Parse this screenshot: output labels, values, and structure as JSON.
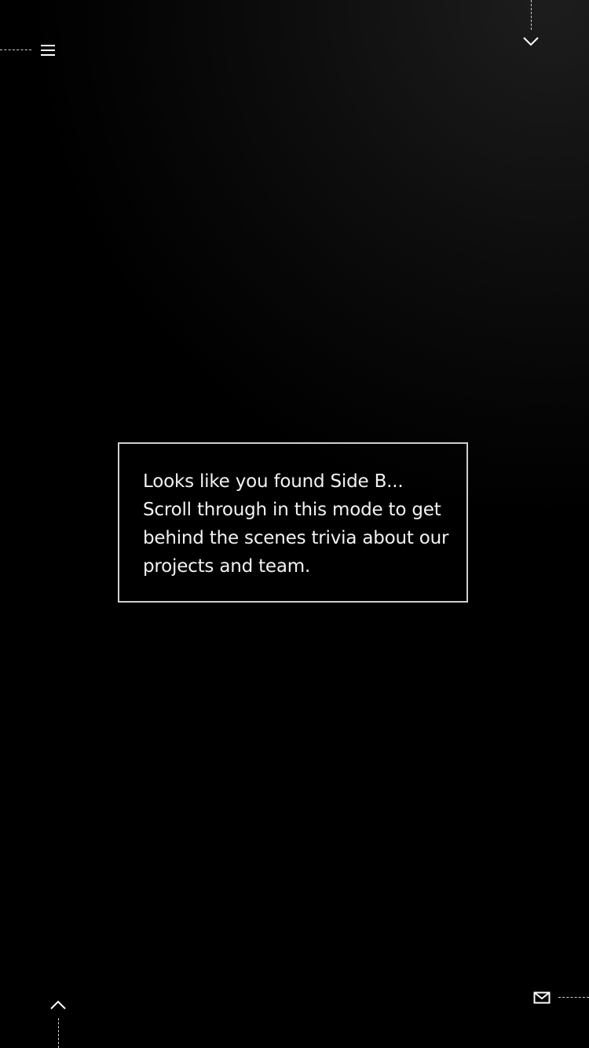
{
  "nav": {
    "menu_icon": "hamburger-menu-icon",
    "scroll_down_icon": "chevron-down-icon",
    "scroll_up_icon": "chevron-up-icon",
    "contact_icon": "envelope-icon"
  },
  "info": {
    "message": "Looks like you found Side B... Scroll through in this mode to get behind the scenes trivia about our projects and team."
  },
  "colors": {
    "background": "#000000",
    "text": "#f2f2f2",
    "border": "#cfcfcf"
  }
}
